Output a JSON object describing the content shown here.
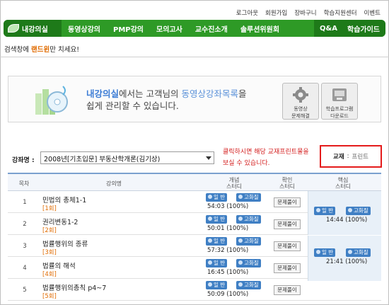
{
  "topbar": [
    "로그아웃",
    "회원가입",
    "장바구니",
    "학습지원센터",
    "이벤트"
  ],
  "nav": {
    "brand": "내강의실",
    "items": [
      "동영상강의",
      "PMP강의",
      "모의고사",
      "교수진소개",
      "솔루션위원회"
    ],
    "right": [
      "Q&A",
      "학습가이드"
    ]
  },
  "search_hint": {
    "prefix": "검색창에 ",
    "keyword": "랜드윈",
    "suffix": "만 치세요!"
  },
  "banner": {
    "part1_blue": "내강의실",
    "part1": "에서는 고객님의 ",
    "part1_lightblue": "동영상강좌목록",
    "part1_end": "을",
    "line2": "쉽게 관리할 수 있습니다.",
    "tool1": [
      "동영상",
      "문제해결"
    ],
    "tool2": [
      "학습프로그램",
      "다운로드"
    ]
  },
  "course": {
    "label": "강좌명 :",
    "selected": "2008년[기초입문] 부동산학개론(김기상)"
  },
  "note": [
    "클릭하시면 해당 교재프린트물을",
    "보실 수 있습니다."
  ],
  "textbook": {
    "label": "교재",
    "link": "프린트"
  },
  "table": {
    "headers": {
      "num": "목차",
      "title": "강의명",
      "concept": [
        "개념",
        "스터디"
      ],
      "check": [
        "확인",
        "스터디"
      ],
      "core": [
        "핵심",
        "스터디"
      ]
    },
    "pill_normal": "일  반",
    "pill_hq": "고화질",
    "quiz_label": "문제풀이",
    "rows": [
      {
        "num": "1",
        "title": "민법의 총체1-1",
        "tag": "[1회]",
        "time": "54:03 (100%)"
      },
      {
        "num": "2",
        "title": "권리변동1-2",
        "tag": "[2회]",
        "time": "50:01 (100%)"
      },
      {
        "num": "3",
        "title": "법률행위의 종류",
        "tag": "[3회]",
        "time": "57:32 (100%)"
      },
      {
        "num": "4",
        "title": "법률의 해석",
        "tag": "[4회]",
        "time": "16:45 (100%)"
      },
      {
        "num": "5",
        "title": "법률행위의총칙 p4~7",
        "tag": "[5회]",
        "time": "50:09 (100%)"
      }
    ],
    "core_groups": [
      {
        "time": "14:44 (100%)"
      },
      {
        "time": "21:41 (100%)"
      }
    ]
  },
  "colors": {
    "nav_green": "#2e9a26",
    "nav_dark_green": "#1e7a19",
    "accent_orange": "#e06b00",
    "note_red": "#d42020",
    "pill_blue": "#3f7fc4"
  }
}
